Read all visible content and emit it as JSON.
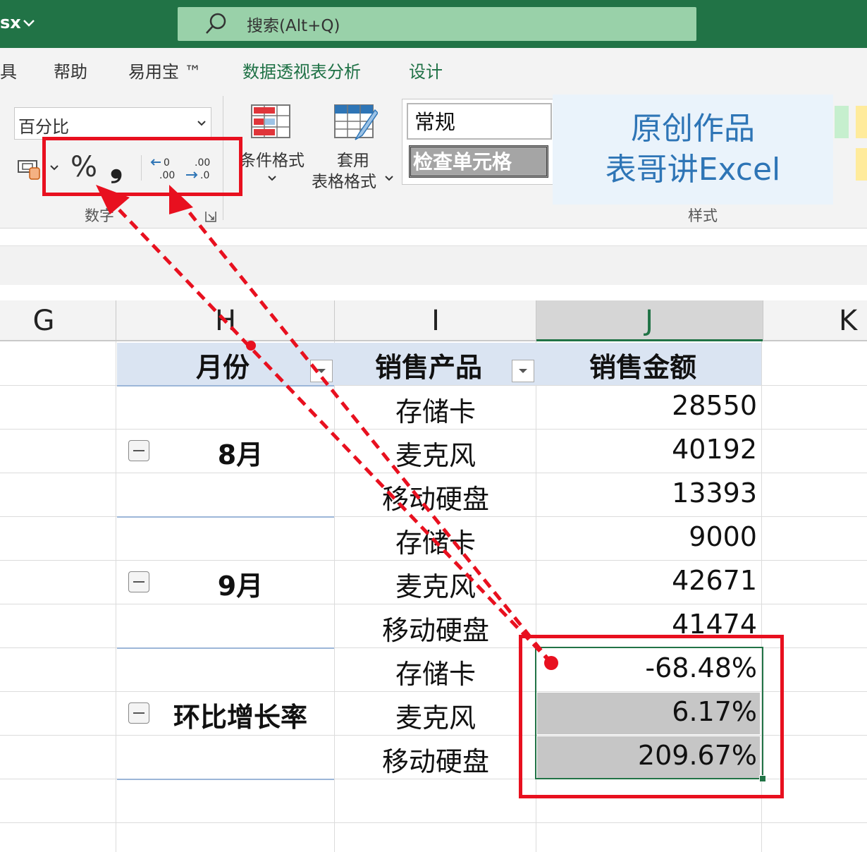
{
  "titlebar": {
    "file_suffix": "sx",
    "search_label": "搜索(Alt+Q)"
  },
  "ribbon": {
    "tabs": [
      "具",
      "帮助",
      "易用宝 ™",
      "数据透视表分析",
      "设计"
    ],
    "number_format_value": "百分比",
    "percent_glyph": "%",
    "comma_glyph": "❟",
    "group_number_label": "数字",
    "conditional_format_label": "条件格式",
    "format_as_table_line1": "套用",
    "format_as_table_line2": "表格格式",
    "style_normal": "常规",
    "style_check_cell": "检查单元格",
    "group_styles_label": "样式",
    "watermark_line1": "原创作品",
    "watermark_line2": "表哥讲Excel"
  },
  "columns": [
    "G",
    "H",
    "I",
    "J",
    "K"
  ],
  "pivot": {
    "headers": {
      "month": "月份",
      "product": "销售产品",
      "amount": "销售金额"
    },
    "groups": [
      {
        "label": "8月",
        "rows": [
          {
            "product": "存储卡",
            "amount": "28550"
          },
          {
            "product": "麦克风",
            "amount": "40192"
          },
          {
            "product": "移动硬盘",
            "amount": "13393"
          }
        ]
      },
      {
        "label": "9月",
        "rows": [
          {
            "product": "存储卡",
            "amount": "9000"
          },
          {
            "product": "麦克风",
            "amount": "42671"
          },
          {
            "product": "移动硬盘",
            "amount": "41474"
          }
        ]
      },
      {
        "label": "环比增长率",
        "rows": [
          {
            "product": "存储卡",
            "amount": "-68.48%"
          },
          {
            "product": "麦克风",
            "amount": "6.17%"
          },
          {
            "product": "移动硬盘",
            "amount": "209.67%"
          }
        ]
      }
    ]
  },
  "colors": {
    "excel_green": "#217346",
    "highlight_red": "#e8101f",
    "pivot_header_blue": "#dae4f2",
    "selection_gray": "#c6c6c6",
    "watermark_blue": "#2e75b6"
  }
}
